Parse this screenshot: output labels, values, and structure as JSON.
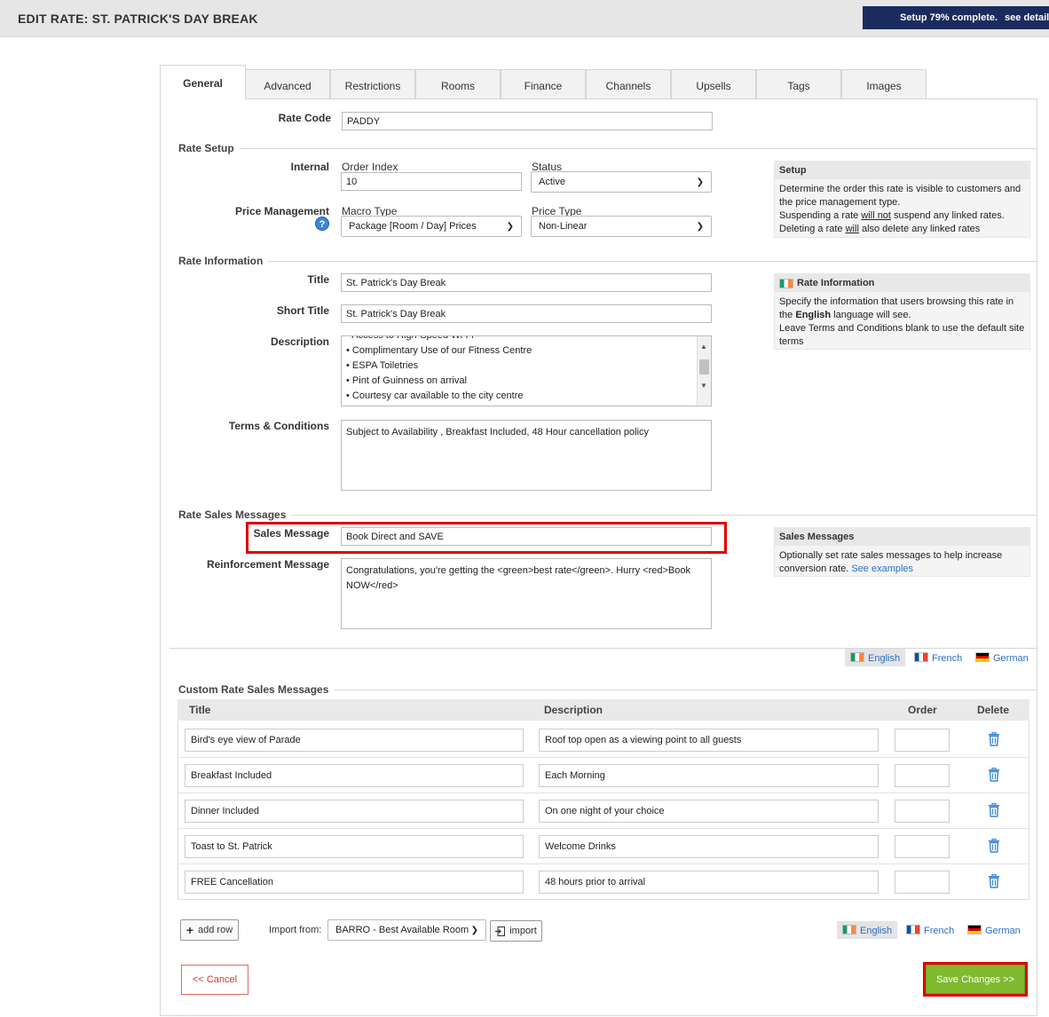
{
  "header": {
    "title": "EDIT RATE: ST. PATRICK'S DAY BREAK",
    "setup_progress": "Setup 79% complete.",
    "setup_link": "see details"
  },
  "tabs": [
    "General",
    "Advanced",
    "Restrictions",
    "Rooms",
    "Finance",
    "Channels",
    "Upsells",
    "Tags",
    "Images"
  ],
  "general": {
    "rate_code_label": "Rate Code",
    "rate_code_value": "PADDY",
    "rate_setup": {
      "section_title": "Rate Setup",
      "internal_label": "Internal",
      "order_index_label": "Order Index",
      "order_index_value": "10",
      "status_label": "Status",
      "status_value": "Active",
      "price_management_label": "Price Management",
      "macro_type_label": "Macro Type",
      "macro_type_value": "Package [Room / Day] Prices",
      "price_type_label": "Price Type",
      "price_type_value": "Non-Linear",
      "help_icon_glyph": "?"
    },
    "setup_info": {
      "title": "Setup",
      "line1": "Determine the order this rate is visible to customers and the price management type.",
      "line2_a": "Suspending a rate ",
      "line2_u": "will not",
      "line2_b": " suspend any linked rates.",
      "line3_a": "Deleting a rate ",
      "line3_u": "will",
      "line3_b": " also delete any linked rates"
    },
    "rate_information": {
      "section_title": "Rate Information",
      "title_label": "Title",
      "title_value": "St. Patrick's Day Break",
      "short_title_label": "Short Title",
      "short_title_value": "St. Patrick's Day Break",
      "description_label": "Description",
      "description_lines": [
        "• Access to High-Speed Wi-Fi",
        "• Complimentary Use of our Fitness Centre",
        "• ESPA Toiletries",
        "• Pint of Guinness on arrival",
        "• Courtesy car available to the city centre"
      ],
      "terms_label": "Terms & Conditions",
      "terms_value": "Subject to Availability , Breakfast Included, 48 Hour cancellation policy"
    },
    "rate_info_box": {
      "title": "Rate Information",
      "line1": "Specify the information that users browsing this rate in the ",
      "line1_bold": "English",
      "line1_end": " language will see.",
      "line2": "Leave Terms and Conditions blank to use the default site terms"
    },
    "sales_messages": {
      "section_title": "Rate Sales Messages",
      "sales_message_label": "Sales Message",
      "sales_message_value": "Book Direct and SAVE",
      "reinforcement_label": "Reinforcement Message",
      "reinforcement_value": "Congratulations, you're getting the <green>best rate</green>. Hurry <red>Book NOW</red>"
    },
    "sales_info_box": {
      "title": "Sales Messages",
      "text": "Optionally set rate sales messages to help increase conversion rate. ",
      "link": "See examples"
    },
    "languages": [
      "English",
      "French",
      "German"
    ],
    "custom_messages": {
      "section_title": "Custom Rate Sales Messages",
      "columns": [
        "Title",
        "Description",
        "Order",
        "Delete"
      ],
      "rows": [
        {
          "title": "Bird's eye view of Parade",
          "description": "Roof top open as a viewing point to all guests",
          "order": ""
        },
        {
          "title": "Breakfast Included",
          "description": "Each Morning",
          "order": ""
        },
        {
          "title": "Dinner Included",
          "description": "On one night of your choice",
          "order": ""
        },
        {
          "title": "Toast to St. Patrick",
          "description": "Welcome Drinks",
          "order": ""
        },
        {
          "title": "FREE Cancellation",
          "description": "48 hours prior to arrival",
          "order": ""
        }
      ],
      "add_row_label": "add row",
      "import_from_label": "Import from:",
      "import_select_value": "BARRO - Best Available Room",
      "import_button_label": "import"
    },
    "actions": {
      "cancel_label": "<< Cancel",
      "save_label": "Save Changes >>"
    }
  },
  "colors": {
    "header_badge": "#1a2b5e",
    "save_button": "#7fba2f",
    "highlight": "#e00000",
    "link": "#2a6fc9"
  }
}
